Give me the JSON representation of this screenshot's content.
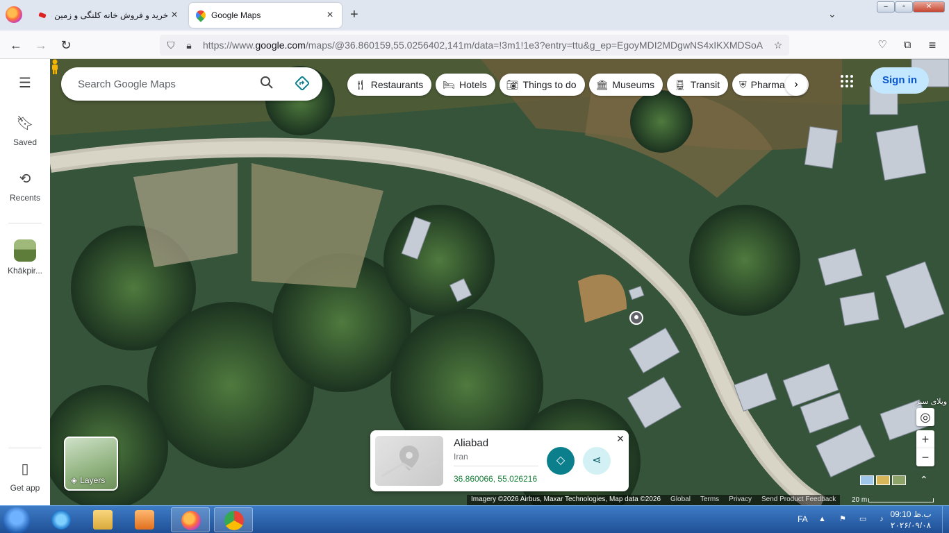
{
  "browser": {
    "tabs": [
      {
        "title": "خرید و فروش خانه کلنگی و زمین در ...",
        "active": false
      },
      {
        "title": "Google Maps",
        "active": true
      }
    ],
    "url_prefix": "https://www.",
    "url_domain": "google.com",
    "url_rest": "/maps/@36.860159,55.0256402,141m/data=!3m1!1e3?entry=ttu&g_ep=EgoyMDI2MDgwNS4xIKXMDSoA"
  },
  "rail": {
    "menu_icon": "hamburger-icon",
    "saved_label": "Saved",
    "recents_label": "Recents",
    "recent_place_label": "Khākpir...",
    "get_app_label": "Get app"
  },
  "search": {
    "placeholder": "Search Google Maps"
  },
  "chips": [
    {
      "label": "Restaurants",
      "icon": "fork-knife-icon"
    },
    {
      "label": "Hotels",
      "icon": "bed-icon"
    },
    {
      "label": "Things to do",
      "icon": "camera-icon"
    },
    {
      "label": "Museums",
      "icon": "museum-icon"
    },
    {
      "label": "Transit",
      "icon": "train-icon"
    },
    {
      "label": "Pharmacies",
      "icon": "pharmacy-icon"
    }
  ],
  "signin_label": "Sign in",
  "layers_label": "Layers",
  "place_card": {
    "title": "Aliabad",
    "subtitle": "Iran",
    "coords": "36.860066, 55.026216"
  },
  "map_poi_label": "ویلای سبز",
  "footer": {
    "attribution": "Imagery ©2026 Airbus, Maxar Technologies, Map data ©2026",
    "links": [
      "Global",
      "Terms",
      "Privacy",
      "Send Product Feedback"
    ],
    "scale": "20 m"
  },
  "taskbar": {
    "lang": "FA",
    "time": "09:10 ب.ظ",
    "date": "۲۰۲۶/۰۹/۰۸"
  },
  "colors": {
    "signin_bg": "#c2e7ff",
    "directions_teal": "#0b7f8c",
    "coords_green": "#188038"
  }
}
